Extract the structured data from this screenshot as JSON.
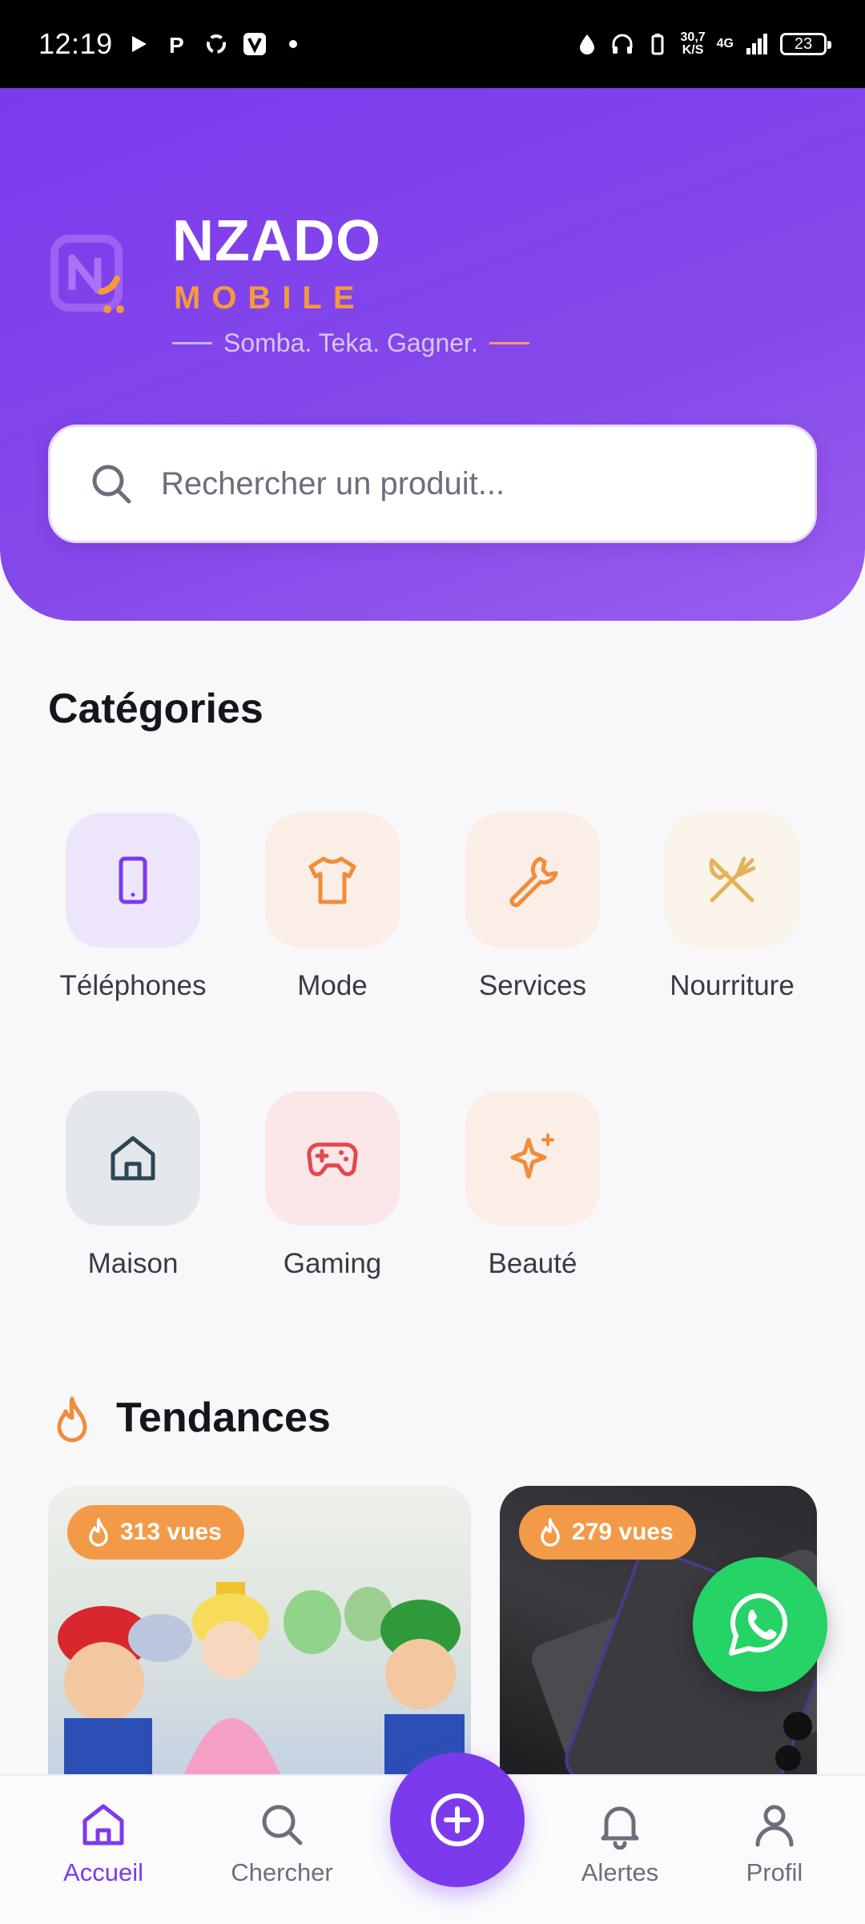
{
  "status_bar": {
    "time": "12:19",
    "speed_value": "30,7",
    "speed_unit": "K/S",
    "network": "4G",
    "battery": "23"
  },
  "brand": {
    "name": "NZADO",
    "subtitle": "MOBILE",
    "tagline": "Somba. Teka. Gagner."
  },
  "search": {
    "placeholder": "Rechercher un produit..."
  },
  "categories": {
    "title": "Catégories",
    "items": [
      {
        "label": "Téléphones",
        "icon": "phone-icon",
        "bg": "#ede6fb",
        "color": "#7c3aed"
      },
      {
        "label": "Mode",
        "icon": "tshirt-icon",
        "bg": "#fbeee6",
        "color": "#f08c3a"
      },
      {
        "label": "Services",
        "icon": "wrench-icon",
        "bg": "#fbeee6",
        "color": "#f08c3a"
      },
      {
        "label": "Nourriture",
        "icon": "utensils-icon",
        "bg": "#faf4ea",
        "color": "#e3b35a"
      },
      {
        "label": "Maison",
        "icon": "home-icon",
        "bg": "#e4e8ec",
        "color": "#2c4656"
      },
      {
        "label": "Gaming",
        "icon": "gamepad-icon",
        "bg": "#fbe6e8",
        "color": "#e2484e"
      },
      {
        "label": "Beauté",
        "icon": "sparkles-icon",
        "bg": "#fbeee6",
        "color": "#f08c3a"
      }
    ]
  },
  "trending": {
    "title": "Tendances",
    "cards": [
      {
        "views": "313 vues"
      },
      {
        "views": "279 vues"
      }
    ]
  },
  "nav": {
    "home": "Accueil",
    "search": "Chercher",
    "alerts": "Alertes",
    "profile": "Profil"
  },
  "colors": {
    "primary": "#7c3aed",
    "accent": "#f59a3c",
    "whatsapp": "#25d366"
  }
}
